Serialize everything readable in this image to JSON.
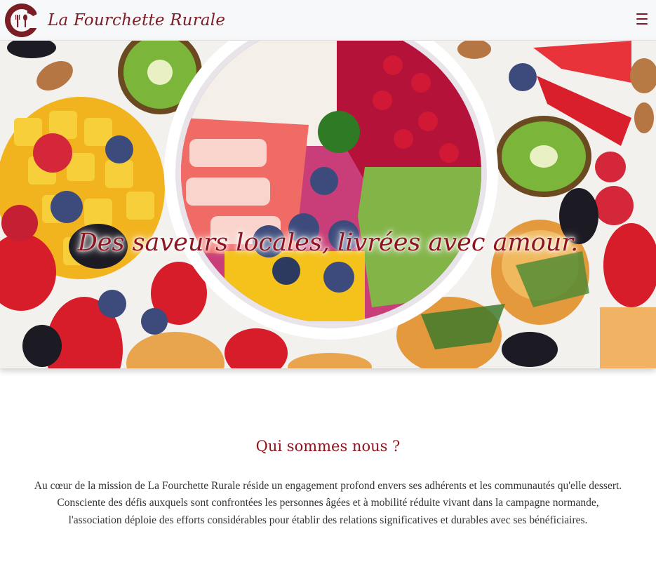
{
  "brand": {
    "name": "La Fourchette Rurale",
    "accent": "#8e1520"
  },
  "nav": {
    "menu_icon": "hamburger-menu-icon"
  },
  "hero": {
    "tagline": "Des saveurs locales, livrées avec amour."
  },
  "about": {
    "heading": "Qui sommes nous ?",
    "body": "Au cœur de la mission de La Fourchette Rurale réside un engagement profond envers ses adhérents et les communautés qu'elle dessert. Consciente des défis auxquels sont confrontées les personnes âgées et à mobilité réduite vivant dans la campagne normande, l'association déploie des efforts considérables pour établir des relations significatives et durables avec ses bénéficiaires."
  }
}
